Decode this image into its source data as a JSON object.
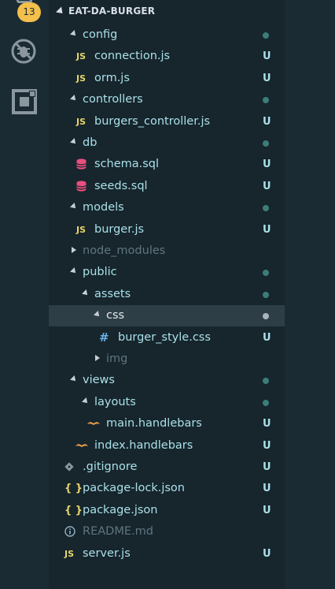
{
  "activity_bar": {
    "badge_count": "13",
    "icons": [
      "source-control-icon",
      "debug-disabled-icon",
      "extensions-icon"
    ]
  },
  "explorer": {
    "project_title": "EAT-DA-BURGER",
    "items": [
      {
        "label": "config",
        "type": "folder-open",
        "depth": 1,
        "status": "dot"
      },
      {
        "label": "connection.js",
        "type": "js",
        "depth": 2,
        "status": "U"
      },
      {
        "label": "orm.js",
        "type": "js",
        "depth": 2,
        "status": "U"
      },
      {
        "label": "controllers",
        "type": "folder-open",
        "depth": 1,
        "status": "dot"
      },
      {
        "label": "burgers_controller.js",
        "type": "js",
        "depth": 2,
        "status": "U"
      },
      {
        "label": "db",
        "type": "folder-open",
        "depth": 1,
        "status": "dot"
      },
      {
        "label": "schema.sql",
        "type": "sql",
        "depth": 2,
        "status": "U"
      },
      {
        "label": "seeds.sql",
        "type": "sql",
        "depth": 2,
        "status": "U"
      },
      {
        "label": "models",
        "type": "folder-open",
        "depth": 1,
        "status": "dot"
      },
      {
        "label": "burger.js",
        "type": "js",
        "depth": 2,
        "status": "U"
      },
      {
        "label": "node_modules",
        "type": "folder-closed",
        "depth": 1,
        "status": ""
      },
      {
        "label": "public",
        "type": "folder-open",
        "depth": 1,
        "status": "dot"
      },
      {
        "label": "assets",
        "type": "folder-open",
        "depth": 2,
        "status": "dot"
      },
      {
        "label": "css",
        "type": "folder-open",
        "depth": 3,
        "status": "dot",
        "selected": true
      },
      {
        "label": "burger_style.css",
        "type": "css",
        "depth": 4,
        "status": "U"
      },
      {
        "label": "img",
        "type": "folder-closed",
        "depth": 3,
        "status": ""
      },
      {
        "label": "views",
        "type": "folder-open",
        "depth": 1,
        "status": "dot"
      },
      {
        "label": "layouts",
        "type": "folder-open",
        "depth": 2,
        "status": "dot"
      },
      {
        "label": "main.handlebars",
        "type": "hbs",
        "depth": 3,
        "status": "U"
      },
      {
        "label": "index.handlebars",
        "type": "hbs",
        "depth": 2,
        "status": "U"
      },
      {
        "label": ".gitignore",
        "type": "git",
        "depth": 1,
        "status": "U"
      },
      {
        "label": "package-lock.json",
        "type": "json",
        "depth": 1,
        "status": "U"
      },
      {
        "label": "package.json",
        "type": "json",
        "depth": 1,
        "status": "U"
      },
      {
        "label": "README.md",
        "type": "info",
        "depth": 1,
        "status": ""
      },
      {
        "label": "server.js",
        "type": "js",
        "depth": 1,
        "status": "U"
      }
    ]
  },
  "icon_glyphs": {
    "js": "JS",
    "css": "#",
    "json": "{ }"
  },
  "colors": {
    "badge": "#f2c04b",
    "tree_text": "#a9e0e8",
    "dim_text": "#5f7680",
    "selected_bg": "#2d3e47",
    "status_dot": "#3c7d7a"
  }
}
